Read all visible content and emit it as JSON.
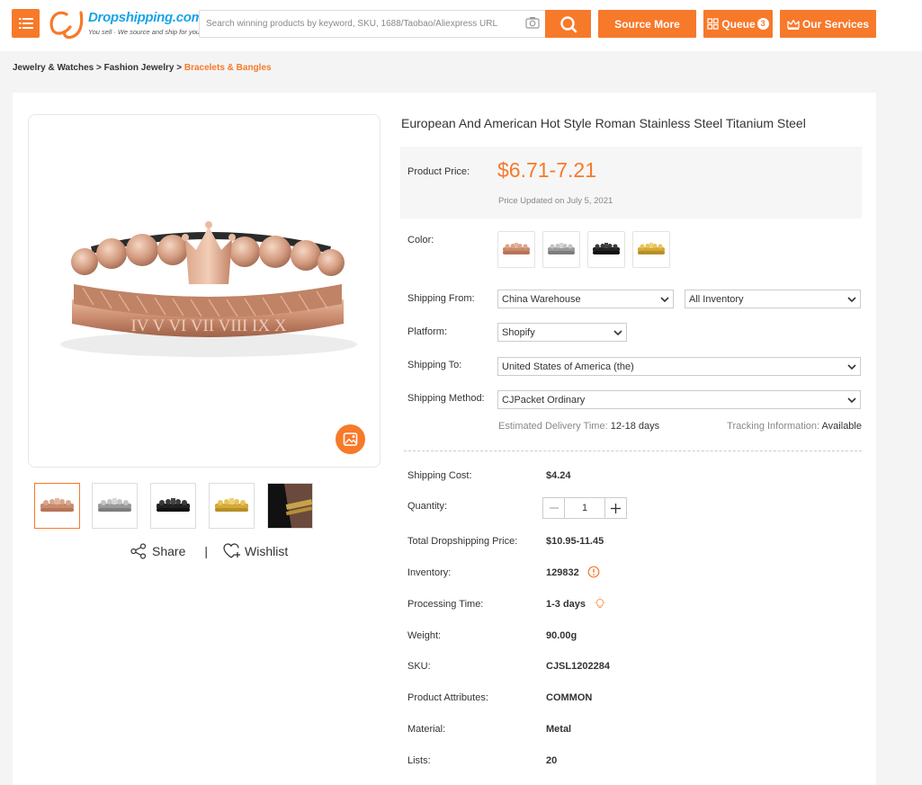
{
  "header": {
    "logo_brand": "Dropshipping.com",
    "logo_tagline": "You sell · We source and ship for you!",
    "search_placeholder": "Search winning products by keyword, SKU, 1688/Taobao/Aliexpress URL",
    "source_more": "Source More",
    "queue_label": "Queue",
    "queue_count": "3",
    "our_services": "Our Services",
    "accent_color": "#f7792a"
  },
  "breadcrumb": {
    "level1": "Jewelry & Watches",
    "sep": ">",
    "level2": "Fashion Jewelry",
    "current": "Bracelets & Bangles"
  },
  "gallery": {
    "share": "Share",
    "divider": "|",
    "wishlist": "Wishlist",
    "thumbnails": [
      "rose-gold",
      "silver",
      "black",
      "gold",
      "worn-on-wrist"
    ]
  },
  "product": {
    "title": "European And American Hot Style Roman Stainless Steel Titanium Steel",
    "price_label": "Product Price:",
    "price": "$6.71-7.21",
    "price_updated": "Price Updated on July 5, 2021",
    "color_label": "Color:",
    "colors": [
      "rose-gold",
      "silver",
      "black",
      "gold"
    ],
    "shipping_from_label": "Shipping From:",
    "shipping_from": "China Warehouse",
    "inventory_filter": "All Inventory",
    "platform_label": "Platform:",
    "platform": "Shopify",
    "shipping_to_label": "Shipping To:",
    "shipping_to": "United States of America (the)",
    "shipping_method_label": "Shipping Method:",
    "shipping_method": "CJPacket Ordinary",
    "delivery_label": "Estimated Delivery Time:",
    "delivery_value": "12-18 days",
    "tracking_label": "Tracking Information:",
    "tracking_value": "Available"
  },
  "details": {
    "shipping_cost_label": "Shipping Cost:",
    "shipping_cost": "$4.24",
    "quantity_label": "Quantity:",
    "quantity": "1",
    "total_label": "Total Dropshipping Price:",
    "total": "$10.95-11.45",
    "inventory_label": "Inventory:",
    "inventory": "129832",
    "processing_label": "Processing Time:",
    "processing": "1-3 days",
    "weight_label": "Weight:",
    "weight": "90.00g",
    "sku_label": "SKU:",
    "sku": "CJSL1202284",
    "attributes_label": "Product Attributes:",
    "attributes": "COMMON",
    "material_label": "Material:",
    "material": "Metal",
    "lists_label": "Lists:",
    "lists": "20"
  }
}
